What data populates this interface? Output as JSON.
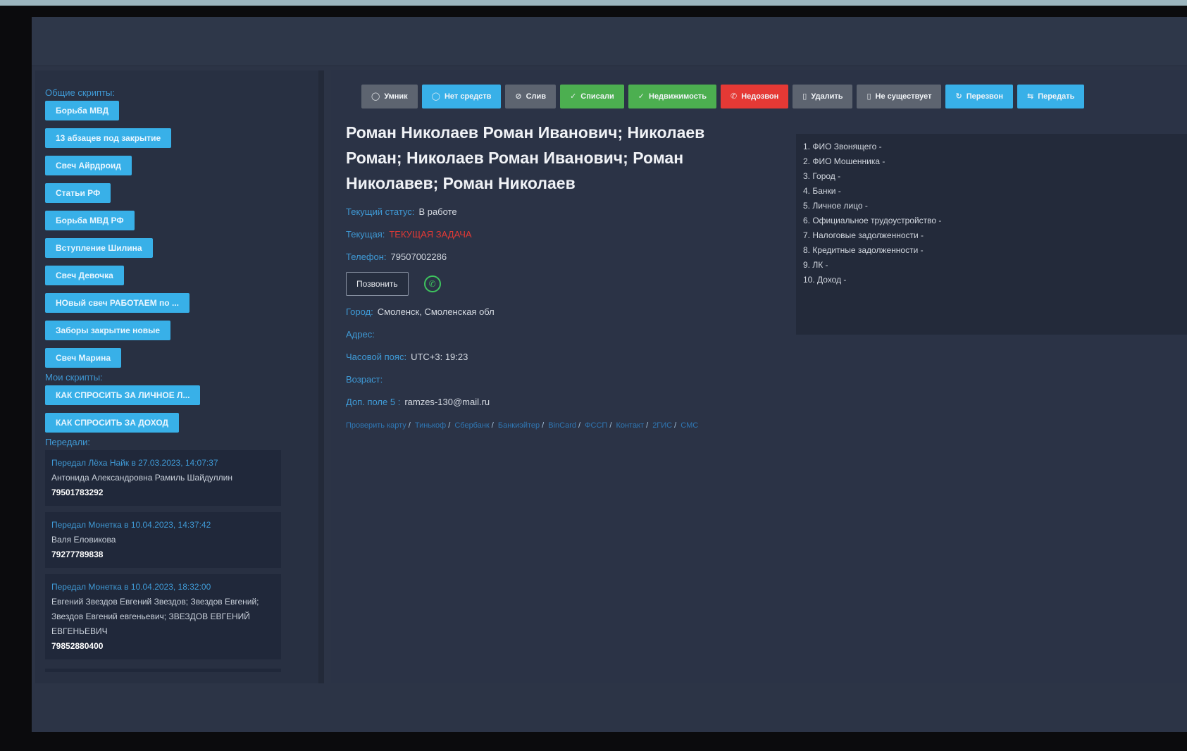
{
  "sidebar": {
    "common_label": "Общие скрипты:",
    "common_scripts": [
      "Борьба МВД",
      "13 абзацев под закрытие",
      "Свеч Айрдроид",
      "Статьи РФ",
      "Борьба МВД РФ",
      "Вступление Шилина",
      "Свеч Девочка",
      "НОвый свеч РАБОТАЕМ по ...",
      "Заборы закрытие новые",
      "Свеч Марина"
    ],
    "my_label": "Мои скрипты:",
    "my_scripts": [
      "КАК СПРОСИТЬ ЗА ЛИЧНОЕ Л...",
      "КАК СПРОСИТЬ ЗА ДОХОД"
    ],
    "transfers_label": "Передали:",
    "transfers": [
      {
        "head": "Передал Лёха Найк в 27.03.2023, 14:07:37",
        "name": "Антонида Александровна Рамиль Шайдуллин",
        "phone": "79501783292"
      },
      {
        "head": "Передал Монетка в 10.04.2023, 14:37:42",
        "name": "Валя Еловикова",
        "phone": "79277789838"
      },
      {
        "head": "Передал Монетка в 10.04.2023, 18:32:00",
        "name": "Евгений Звездов Евгений Звездов; Звездов Евгений; Звездов Евгений евгеньевич; ЗВЕЗДОВ ЕВГЕНИЙ ЕВГЕНЬЕВИЧ",
        "phone": "79852880400"
      }
    ]
  },
  "toolbar": [
    {
      "label": "Умник",
      "icon": "circle-icon",
      "color": "#5d6470"
    },
    {
      "label": "Нет средств",
      "icon": "circle-icon",
      "color": "#38b0e8"
    },
    {
      "label": "Слив",
      "icon": "ban-icon",
      "color": "#5d6470"
    },
    {
      "label": "Списали",
      "icon": "check-circle-icon",
      "color": "#4caf50"
    },
    {
      "label": "Недвижимость",
      "icon": "check-circle-icon",
      "color": "#4caf50"
    },
    {
      "label": "Недозвон",
      "icon": "phone-icon",
      "color": "#e53935"
    },
    {
      "label": "Удалить",
      "icon": "trash-icon",
      "color": "#5d6470"
    },
    {
      "label": "Не существует",
      "icon": "trash-icon",
      "color": "#5d6470"
    },
    {
      "label": "Перезвон",
      "icon": "refresh-icon",
      "color": "#38b0e8"
    },
    {
      "label": "Передать",
      "icon": "transfer-icon",
      "color": "#38b0e8"
    }
  ],
  "card": {
    "title": "Роман Николаев Роман Иванович; Николаев Роман; Николаев Роман Иванович; Роман Николавев; Роман Николаев",
    "status_label": "Текущий статус:",
    "status_value": "В работе",
    "task_label": "Текущая:",
    "task_value": "ТЕКУЩАЯ ЗАДАЧА",
    "phone_label": "Телефон:",
    "phone_value": "79507002286",
    "call_label": "Позвонить",
    "city_label": "Город:",
    "city_value": "Смоленск, Смоленская обл",
    "address_label": "Адрес:",
    "timezone_label": "Часовой пояс:",
    "timezone_value": "UTC+3: 19:23",
    "age_label": "Возраст:",
    "extra_label": "Доп. поле 5 :",
    "extra_value": "ramzes-130@mail.ru",
    "links": [
      "Проверить карту",
      "Тинькоф",
      "Сбербанк",
      "Банкиэйтер",
      "BinCard",
      "ФССП",
      "Контакт",
      "2ГИС",
      "СМС"
    ]
  },
  "checklist": [
    "1. ФИО Звонящего -",
    "2. ФИО Мошенника -",
    "3. Город -",
    "4. Банки -",
    "5. Личное лицо -",
    "6. Официальное трудоустройство -",
    "7. Налоговые задолженности -",
    "8. Кредитные задолженности -",
    "9. ЛК -",
    "10. Доход -"
  ]
}
